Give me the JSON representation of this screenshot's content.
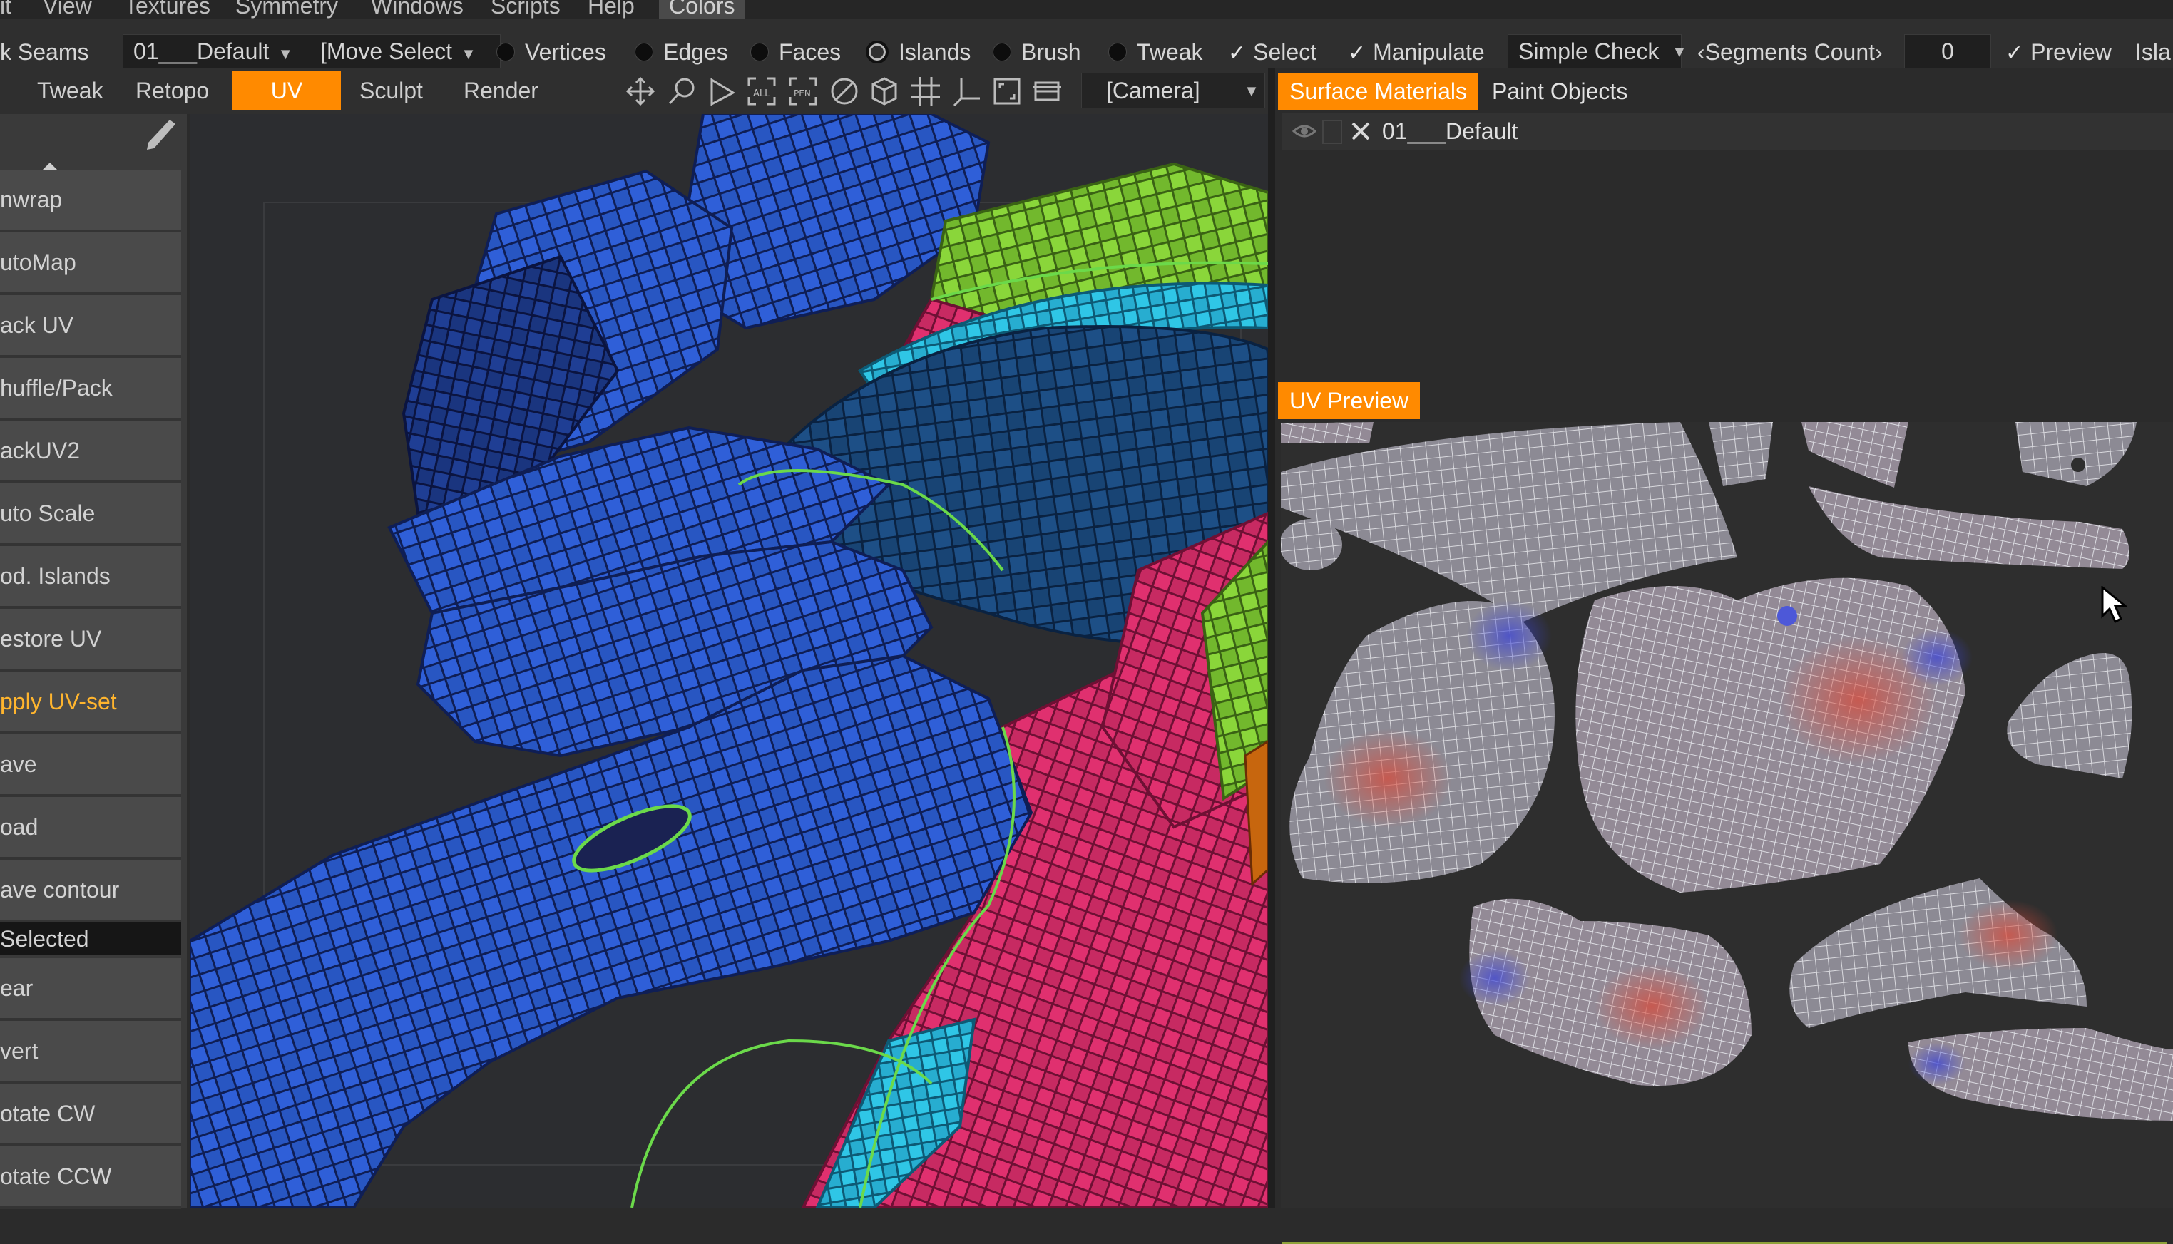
{
  "menubar": {
    "items": [
      "it",
      "View",
      "Textures",
      "Symmetry",
      "Windows",
      "Scripts",
      "Help",
      "Colors"
    ]
  },
  "toolbar1": {
    "seams_label": "k Seams",
    "material_select": "01___Default",
    "mode_select": "[Move Select",
    "selection_modes": [
      {
        "label": "Vertices",
        "selected": false
      },
      {
        "label": "Edges",
        "selected": false
      },
      {
        "label": "Faces",
        "selected": false
      },
      {
        "label": "Islands",
        "selected": true
      },
      {
        "label": "Brush",
        "selected": false
      },
      {
        "label": "Tweak",
        "selected": false
      }
    ],
    "select_label": "Select",
    "select_checked": true,
    "manipulate_label": "Manipulate",
    "manipulate_checked": true,
    "check_select": "Simple Check",
    "segments_label": "Segments Count",
    "segments_value": "0",
    "preview_label": "Preview",
    "preview_checked": true,
    "islands_label": "Isla"
  },
  "toolbar2": {
    "tabs": [
      {
        "label": "Tweak",
        "active": false
      },
      {
        "label": "Retopo",
        "active": false
      },
      {
        "label": "UV",
        "active": true
      },
      {
        "label": "Sculpt",
        "active": false
      },
      {
        "label": "Render",
        "active": false
      }
    ],
    "camera_select": "[Camera]",
    "icons": [
      "move-icon",
      "zoom-icon",
      "play-icon",
      "fit-all-icon",
      "fit-selected-icon",
      "no-entry-icon",
      "cube-icon",
      "grid-icon",
      "axes-icon",
      "frame-icon",
      "layers-icon"
    ]
  },
  "left_panel": {
    "buttons": [
      {
        "label": "nwrap",
        "highlight": false
      },
      {
        "label": "utoMap",
        "highlight": false
      },
      {
        "label": "ack UV",
        "highlight": false
      },
      {
        "label": "huffle/Pack",
        "highlight": false
      },
      {
        "label": "ackUV2",
        "highlight": false
      },
      {
        "label": "uto Scale",
        "highlight": false
      },
      {
        "label": "od. Islands",
        "highlight": false
      },
      {
        "label": "estore UV",
        "highlight": false
      },
      {
        "label": "pply UV-set",
        "highlight": true
      },
      {
        "label": "ave",
        "highlight": false
      },
      {
        "label": "oad",
        "highlight": false
      },
      {
        "label": "ave contour",
        "highlight": false
      }
    ],
    "selected_header": "Selected",
    "selected_buttons": [
      {
        "label": "ear"
      },
      {
        "label": "vert"
      },
      {
        "label": "otate CW"
      },
      {
        "label": "otate CCW"
      }
    ]
  },
  "right_panel": {
    "tabs": [
      {
        "label": "Surface Materials",
        "active": true
      },
      {
        "label": "Paint Objects",
        "active": false
      }
    ],
    "material_name": "01___Default",
    "uv_preview_tab": "UV Preview"
  },
  "colors": {
    "accent": "#ff8a00",
    "highlight_text": "#ffb52e",
    "mesh_blue": "#2f5fd8",
    "mesh_pink": "#e0306f",
    "mesh_green": "#8ad63a",
    "mesh_cyan": "#2fc6e6"
  }
}
